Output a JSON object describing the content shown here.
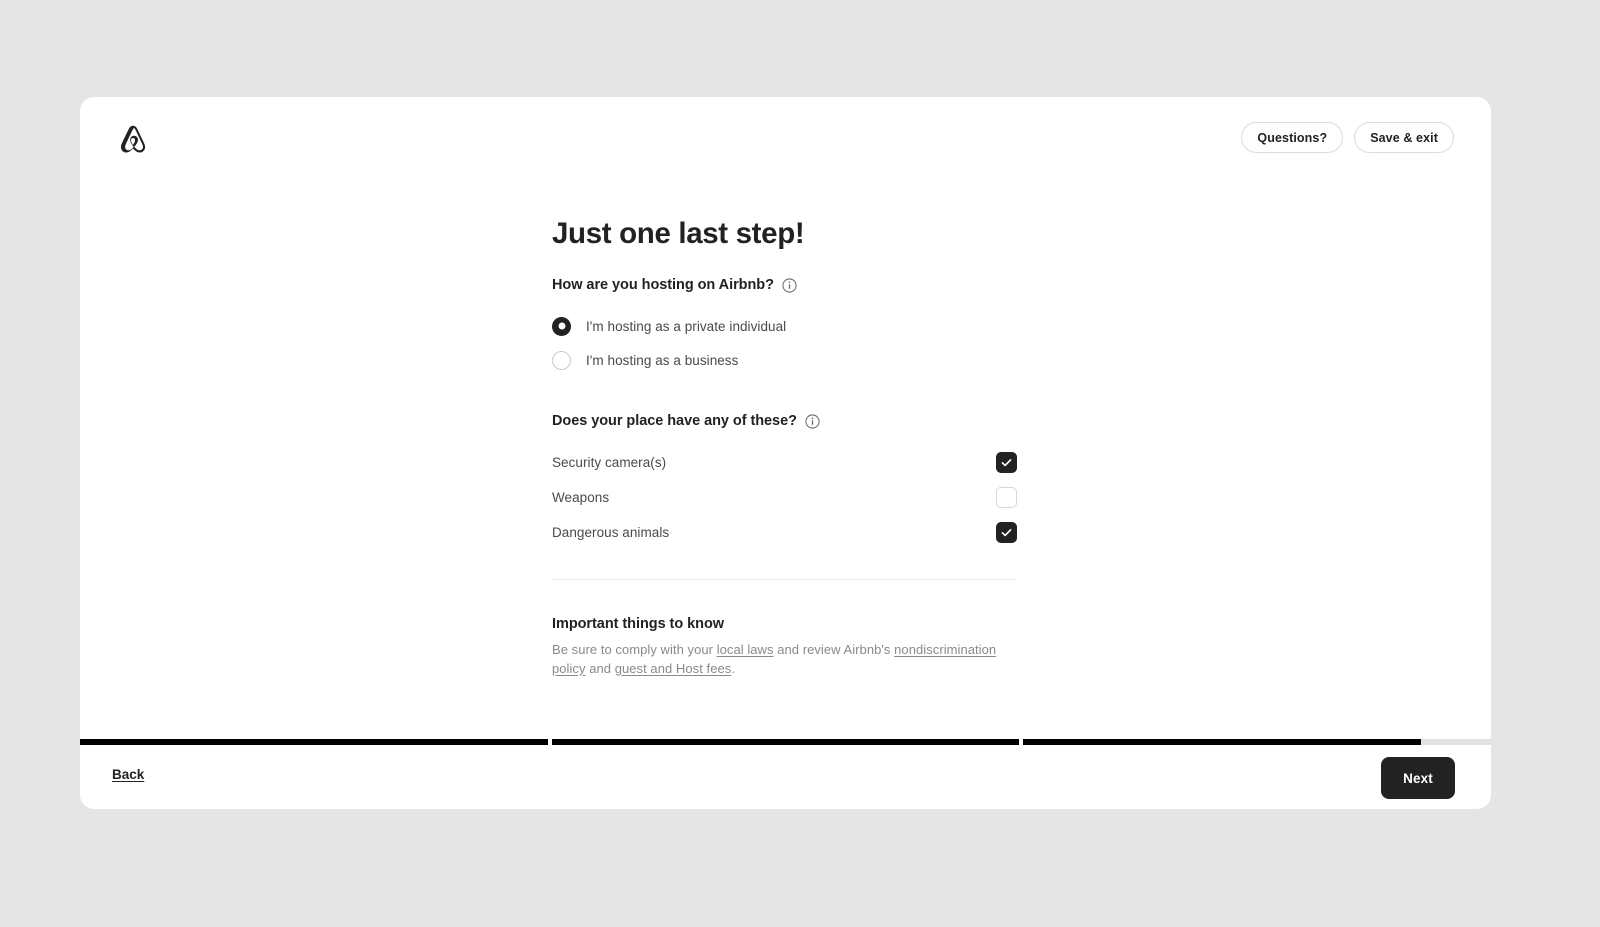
{
  "header": {
    "logo_icon": "airbnb-belo-logo",
    "questions_label": "Questions?",
    "save_exit_label": "Save & exit"
  },
  "main": {
    "title": "Just one last step!",
    "hosting_question": {
      "label": "How are you hosting on Airbnb?",
      "info_icon": "info-circle-icon",
      "options": [
        {
          "label": "I'm hosting as a private individual",
          "selected": true
        },
        {
          "label": "I'm hosting as a business",
          "selected": false
        }
      ]
    },
    "place_question": {
      "label": "Does your place have any of these?",
      "info_icon": "info-circle-icon",
      "items": [
        {
          "label": "Security camera(s)",
          "checked": true
        },
        {
          "label": "Weapons",
          "checked": false
        },
        {
          "label": "Dangerous animals",
          "checked": true
        }
      ]
    },
    "important": {
      "title": "Important things to know",
      "text_part1": "Be sure to comply with your ",
      "link_local_laws": "local laws",
      "text_part2": " and review Airbnb's ",
      "link_nondiscrimination": "nondiscrimination policy",
      "text_part3": " and ",
      "link_fees": "guest and Host fees",
      "text_part4": "."
    }
  },
  "footer": {
    "back_label": "Back",
    "next_label": "Next",
    "progress_segments": [
      100,
      100,
      85
    ]
  },
  "colors": {
    "page_background": "#e5e5e5",
    "card_background": "#ffffff",
    "primary_dark": "#222222",
    "muted_text": "#8a8a8a",
    "border": "#dcdcdc",
    "progress_track": "#e2e2e2"
  }
}
